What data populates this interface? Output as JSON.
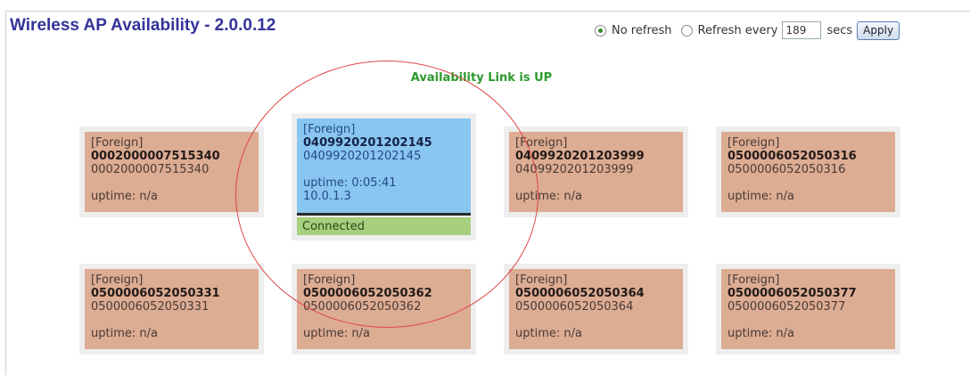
{
  "header": {
    "title": "Wireless AP Availability - 2.0.0.12"
  },
  "refresh": {
    "no_refresh_label": "No refresh",
    "refresh_every_label": "Refresh every",
    "secs_value": "189",
    "secs_label": "secs",
    "apply_label": "Apply",
    "selected": "no_refresh"
  },
  "status": {
    "text": "Availability Link is UP",
    "color": "#2c9a2c"
  },
  "access_points": [
    {
      "tag": "[Foreign]",
      "id": "0002000007515340",
      "id2": "0002000007515340",
      "uptime": "uptime: n/a"
    },
    {
      "tag": "[Foreign]",
      "id": "0409920201202145",
      "id2": "0409920201202145",
      "uptime": "uptime: 0:05:41",
      "ip": "10.0.1.3",
      "connection": "Connected"
    },
    {
      "tag": "[Foreign]",
      "id": "0409920201203999",
      "id2": "0409920201203999",
      "uptime": "uptime: n/a"
    },
    {
      "tag": "[Foreign]",
      "id": "0500006052050316",
      "id2": "0500006052050316",
      "uptime": "uptime: n/a"
    },
    {
      "tag": "[Foreign]",
      "id": "0500006052050331",
      "id2": "0500006052050331",
      "uptime": "uptime: n/a"
    },
    {
      "tag": "[Foreign]",
      "id": "0500006052050362",
      "id2": "0500006052050362",
      "uptime": "uptime: n/a"
    },
    {
      "tag": "[Foreign]",
      "id": "0500006052050364",
      "id2": "0500006052050364",
      "uptime": "uptime: n/a"
    },
    {
      "tag": "[Foreign]",
      "id": "0500006052050377",
      "id2": "0500006052050377",
      "uptime": "uptime: n/a"
    }
  ],
  "colors": {
    "inactive_card": "#dcac93",
    "active_card": "#89c6f0",
    "connected_bar": "#a6cf7e",
    "title": "#33339a",
    "highlight_circle": "#e04848"
  }
}
